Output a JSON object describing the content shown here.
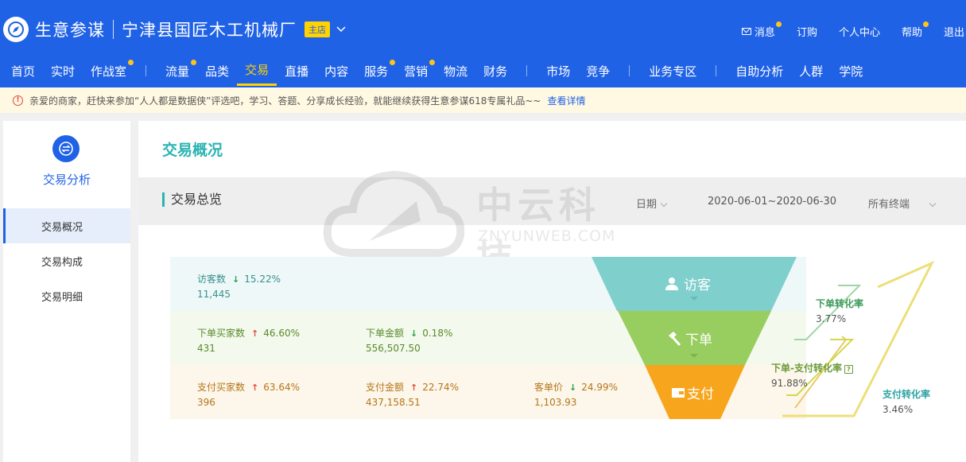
{
  "header": {
    "brand": "生意参谋",
    "shop_name": "宁津县国匠木工机械厂",
    "shop_tag": "主店",
    "links": [
      {
        "label": "消息",
        "dot": true
      },
      {
        "label": "订购",
        "dot": false
      },
      {
        "label": "个人中心",
        "dot": false
      },
      {
        "label": "帮助",
        "dot": true
      },
      {
        "label": "退出",
        "dot": false
      }
    ]
  },
  "nav": {
    "items": [
      "首页",
      "实时",
      "作战室",
      "流量",
      "品类",
      "交易",
      "直播",
      "内容",
      "服务",
      "营销",
      "物流",
      "财务",
      "市场",
      "竞争",
      "业务专区",
      "自助分析",
      "人群",
      "学院"
    ],
    "active": "交易"
  },
  "notice": {
    "text": "亲爱的商家，赶快来参加“人人都是数据侠”评选吧，学习、答题、分享成长经验，就能继续获得生意参谋618专属礼品~~",
    "link": "查看详情"
  },
  "sidebar": {
    "title": "交易分析",
    "items": [
      "交易概况",
      "交易构成",
      "交易明细"
    ],
    "active": "交易概况"
  },
  "main": {
    "page_title": "交易概况",
    "section_title": "交易总览",
    "filter_date_label": "日期",
    "filter_date_value": "2020-06-01~2020-06-30",
    "filter_terminal": "所有终端"
  },
  "watermark": {
    "text": "中云科技",
    "sub": "ZNYUNWEB.COM"
  },
  "metrics": {
    "visitors": {
      "label": "访客数",
      "trend": "down",
      "pct": "15.22%",
      "value": "11,445"
    },
    "order_buyers": {
      "label": "下单买家数",
      "trend": "up",
      "pct": "46.60%",
      "value": "431"
    },
    "order_amount": {
      "label": "下单金额",
      "trend": "down",
      "pct": "0.18%",
      "value": "556,507.50"
    },
    "pay_buyers": {
      "label": "支付买家数",
      "trend": "up",
      "pct": "63.64%",
      "value": "396"
    },
    "pay_amount": {
      "label": "支付金额",
      "trend": "up",
      "pct": "22.74%",
      "value": "437,158.51"
    },
    "unit_price": {
      "label": "客单价",
      "trend": "down",
      "pct": "24.99%",
      "value": "1,103.93"
    }
  },
  "funnel": {
    "stage_visit": "访客",
    "stage_order": "下单",
    "stage_pay": "支付",
    "colors": {
      "visit": "#7fcfcd",
      "order": "#98cd5f",
      "pay": "#f7a51c"
    }
  },
  "rates": {
    "order_rate": {
      "label": "下单转化率",
      "value": "3.77%"
    },
    "order_pay_rate": {
      "label": "下单-支付转化率",
      "value": "91.88%"
    },
    "pay_rate": {
      "label": "支付转化率",
      "value": "3.46%"
    }
  }
}
